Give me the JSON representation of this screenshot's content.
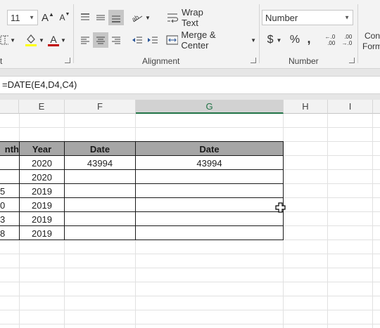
{
  "ribbon": {
    "font": {
      "size": "11",
      "grow_glyph": "A",
      "shrink_glyph": "A",
      "font_color_glyph": "A"
    },
    "alignment": {
      "wrap_text_label": "Wrap Text",
      "merge_center_label": "Merge & Center",
      "group_label": "Alignment"
    },
    "number": {
      "format_value": "Number",
      "currency_glyph": "$",
      "percent_glyph": "%",
      "comma_glyph": ",",
      "increase_decimal_glyph": "←.0\n.00",
      "decrease_decimal_glyph": ".00\n→.0",
      "group_label": "Number"
    },
    "font_group_label_partial": "t",
    "styles_partial": {
      "line1": "Con",
      "line2": "Form"
    }
  },
  "formula_bar": {
    "formula": "=DATE(E4,D4,C4)"
  },
  "columns": [
    "E",
    "F",
    "G",
    "H",
    "I"
  ],
  "table": {
    "headers": [
      "nth",
      "Year",
      "Date",
      "Date"
    ],
    "rows": [
      {
        "d": "",
        "e": "2020",
        "f": "43994",
        "g": "43994"
      },
      {
        "d": "",
        "e": "2020",
        "f": "",
        "g": ""
      },
      {
        "d": "5",
        "e": "2019",
        "f": "",
        "g": ""
      },
      {
        "d": "0",
        "e": "2019",
        "f": "",
        "g": ""
      },
      {
        "d": "3",
        "e": "2019",
        "f": "",
        "g": ""
      },
      {
        "d": "8",
        "e": "2019",
        "f": "",
        "g": ""
      }
    ]
  },
  "colors": {
    "ribbon_bg": "#f3f3f3",
    "selected_col_text": "#217346",
    "header_fill": "#a6a6a6",
    "font_color_bar": "#c00000",
    "fill_color_bar": "#ffff00"
  },
  "icons": [
    "font-size-dropdown",
    "grow-font-icon",
    "shrink-font-icon",
    "top-align-icon",
    "middle-align-icon",
    "bottom-align-icon",
    "orientation-icon",
    "wrap-text-icon",
    "borders-icon",
    "fill-color-icon",
    "font-color-icon",
    "align-left-icon",
    "align-center-icon",
    "align-right-icon",
    "decrease-indent-icon",
    "increase-indent-icon",
    "merge-center-icon",
    "number-format-dropdown",
    "accounting-icon",
    "percent-icon",
    "comma-style-icon",
    "increase-decimal-icon",
    "decrease-decimal-icon",
    "cell-cursor-icon"
  ]
}
